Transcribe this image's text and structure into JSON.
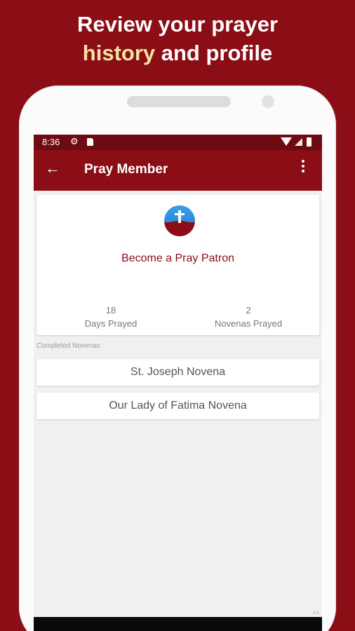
{
  "headline": {
    "line1": "Review your prayer",
    "highlight": "history",
    "line2_rest": " and profile"
  },
  "status_bar": {
    "time": "8:36",
    "icons": [
      "gear-icon",
      "sd-card-icon",
      "wifi-icon",
      "signal-icon",
      "battery-icon"
    ]
  },
  "app_bar": {
    "title": "Pray Member",
    "back_icon": "arrow-left-icon",
    "menu_icon": "more-vert-icon"
  },
  "profile": {
    "patron_label": "Become a Pray Patron",
    "stats": [
      {
        "value": "18",
        "label": "Days Prayed"
      },
      {
        "value": "2",
        "label": "Novenas Prayed"
      }
    ]
  },
  "completed": {
    "section_label": "Completed Novenas",
    "items": [
      "St. Joseph Novena",
      "Our Lady of Fatima Novena"
    ]
  },
  "footer": {
    "version": "1.0"
  },
  "colors": {
    "brand": "#8b0d16",
    "status_bar": "#6e0a12",
    "highlight": "#f4e3a4"
  }
}
